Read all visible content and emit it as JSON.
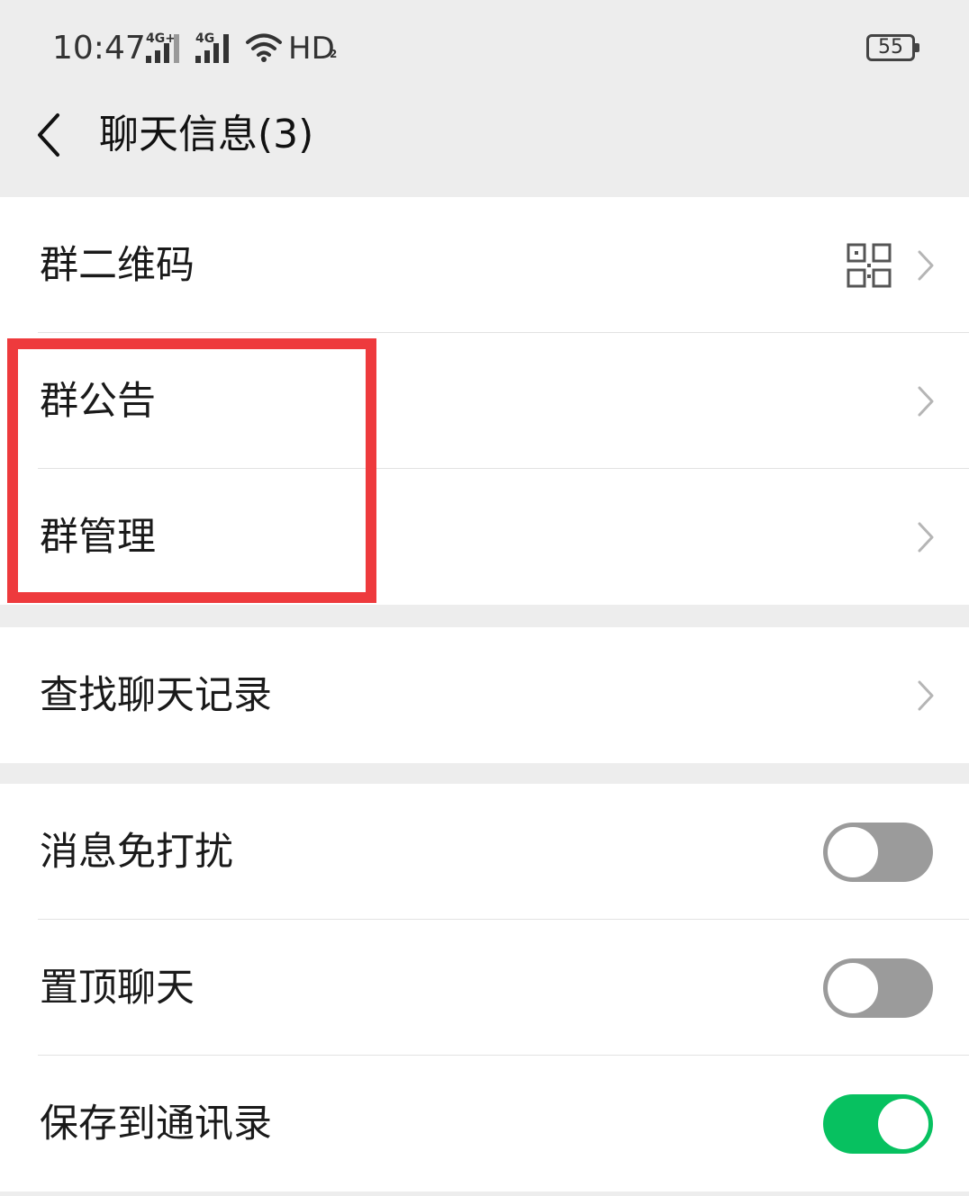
{
  "status_bar": {
    "time": "10:47",
    "signal_1_label": "4G+",
    "signal_2_label": "4G",
    "hd_label": "HD",
    "hd_sub": "2",
    "battery_level": "55"
  },
  "nav": {
    "title": "聊天信息(3)",
    "back_icon": "chevron-left-icon"
  },
  "groups": [
    {
      "items": [
        {
          "label": "群二维码",
          "accessory": "qr-code-icon"
        },
        {
          "label": "群公告",
          "accessory": "chevron"
        },
        {
          "label": "群管理",
          "accessory": "chevron"
        }
      ]
    },
    {
      "items": [
        {
          "label": "查找聊天记录",
          "accessory": "chevron"
        }
      ]
    },
    {
      "items": [
        {
          "label": "消息免打扰",
          "toggle": false
        },
        {
          "label": "置顶聊天",
          "toggle": false
        },
        {
          "label": "保存到通讯录",
          "toggle": true
        }
      ]
    }
  ],
  "colors": {
    "toggle_on": "#07c160",
    "toggle_off": "#9b9b9b",
    "highlight": "#ee3a3d",
    "background": "#ededed"
  }
}
